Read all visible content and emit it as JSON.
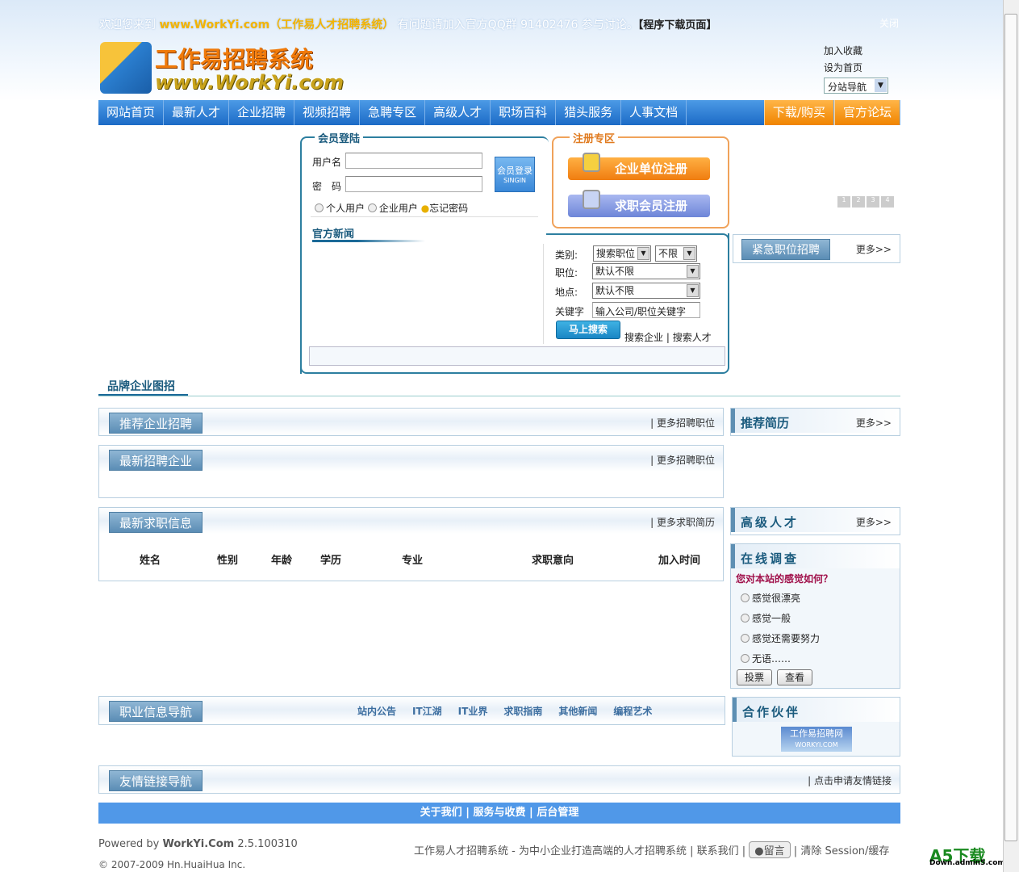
{
  "top": {
    "welcome_prefix": "欢迎您来到",
    "site": "www.WorkYi.com（工作易人才招聘系统）",
    "welcome_suffix": "有问题请加入官方QQ群 91402476 参与讨论。",
    "download": "【程序下载页面】",
    "close": "关闭"
  },
  "logo": {
    "cn": "工作易招聘系统",
    "en": "www.WorkYi.com"
  },
  "links": {
    "favorite": "加入收藏",
    "homepage": "设为首页",
    "substation": "分站导航"
  },
  "nav": [
    "网站首页",
    "最新人才",
    "企业招聘",
    "视频招聘",
    "急聘专区",
    "高级人才",
    "职场百科",
    "猎头服务",
    "人事文档"
  ],
  "nav_right": [
    "下载/购买",
    "官方论坛"
  ],
  "login": {
    "legend": "会员登陆",
    "username_label": "用户名",
    "password_label": "密　码",
    "button": "会员登录",
    "button_sub": "SINGIN",
    "personal": "个人用户",
    "company": "企业用户",
    "forgot": "忘记密码",
    "news_title": "官方新闻"
  },
  "register": {
    "legend": "注册专区",
    "company": "企业单位注册",
    "jobseeker": "求职会员注册"
  },
  "pager": [
    "1",
    "2",
    "3",
    "4"
  ],
  "search": {
    "type_label": "类别:",
    "type_value": "搜索职位",
    "range_value": "不限",
    "position_label": "职位:",
    "position_value": "默认不限",
    "place_label": "地点:",
    "place_value": "默认不限",
    "keyword_label": "关键字",
    "keyword_placeholder": "输入公司/职位关键字",
    "go": "马上搜索",
    "search_company": "搜索企业",
    "search_talent": "搜索人才"
  },
  "urgent": {
    "title": "紧急职位招聘",
    "more": "更多>>"
  },
  "brand": {
    "title": "品牌企业图招"
  },
  "sections": {
    "recommend": {
      "title": "推荐企业招聘",
      "more": "| 更多招聘职位"
    },
    "latest_company": {
      "title": "最新招聘企业",
      "more": "| 更多招聘职位"
    },
    "latest_jobseek": {
      "title": "最新求职信息",
      "more": "| 更多求职简历",
      "columns": [
        "姓名",
        "性别",
        "年龄",
        "学历",
        "专业",
        "求职意向",
        "加入时间"
      ]
    },
    "career_nav": {
      "title": "职业信息导航",
      "links": [
        "站内公告",
        "IT江湖",
        "IT业界",
        "求职指南",
        "其他新闻",
        "编程艺术"
      ]
    },
    "friend_links": {
      "title": "友情链接导航",
      "more": "| 点击申请友情链接"
    }
  },
  "right": {
    "resume": {
      "title": "推荐简历",
      "more": "更多>>"
    },
    "senior": {
      "title": "高级人才",
      "more": "更多>>"
    },
    "survey": {
      "title": "在线调查",
      "question": "您对本站的感觉如何？",
      "options": [
        "感觉很漂亮",
        "感觉一般",
        "感觉还需要努力",
        "无语……"
      ],
      "vote": "投票",
      "view": "查看"
    },
    "partners": {
      "title": "合作伙伴",
      "logo_text": "工作易招聘网",
      "logo_sub": "WORKYI.COM"
    }
  },
  "footer": {
    "links": [
      "关于我们",
      "服务与收费",
      "后台管理"
    ],
    "powered_prefix": "Powered by",
    "powered_brand": "WorkYi.Com",
    "version": "2.5.100310",
    "copyright": "© 2007-2009 Hn.HuaiHua Inc.",
    "slogan": "工作易人才招聘系统 - 为中小企业打造高端的人才招聘系统",
    "contact": "联系我们",
    "guestbook": "留言",
    "clear": "清除 Session/缓存",
    "watermark": "A5下载",
    "watermark_sub": "Down.admin5.com"
  }
}
